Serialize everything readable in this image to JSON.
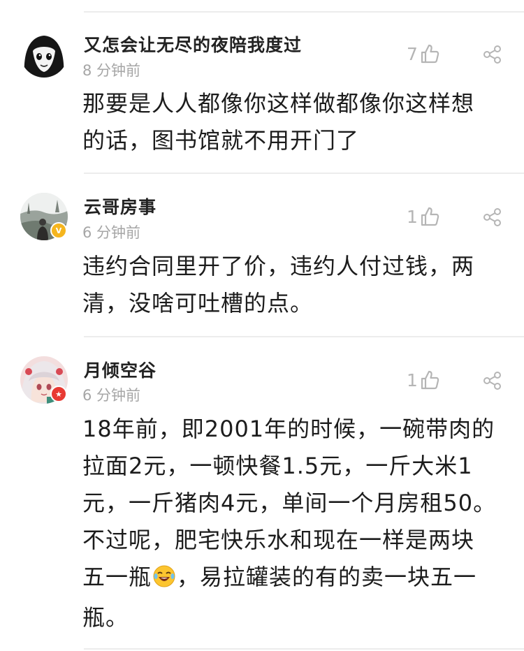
{
  "comments": [
    {
      "username": "又怎会让无尽的夜陪我度过",
      "time": "8 分钟前",
      "likes": "7",
      "text": "那要是人人都像你这样做都像你这样想\n的话，图书馆就不用开门了",
      "avatar_icon": "manga-girl-avatar",
      "badge": ""
    },
    {
      "username": "云哥房事",
      "time": "6 分钟前",
      "likes": "1",
      "text": "违约合同里开了价，违约人付过钱，两\n清，没啥可吐槽的点。",
      "avatar_icon": "landscape-photo-avatar",
      "badge": "V"
    },
    {
      "username": "月倾空谷",
      "time": "6 分钟前",
      "likes": "1",
      "text_before_emoji": "18年前，即2001年的时候，一碗带肉的\n拉面2元，一顿快餐1.5元，一斤大米1\n元，一斤猪肉4元，单间一个月房租50。\n不过呢，肥宅快乐水和现在一样是两块\n五一瓶",
      "text_after_emoji": "，易拉罐装的有的卖一块五一\n瓶。",
      "emoji_icon": "laughing-tears-emoji",
      "avatar_icon": "anime-girl-avatar",
      "badge": "★"
    }
  ],
  "colors": {
    "username": "#222222",
    "time": "#a6a6a6",
    "icon_gray": "#b5b5b5",
    "divider": "#ececec",
    "badge_v": "#f5b51e",
    "badge_star": "#e83a33"
  }
}
